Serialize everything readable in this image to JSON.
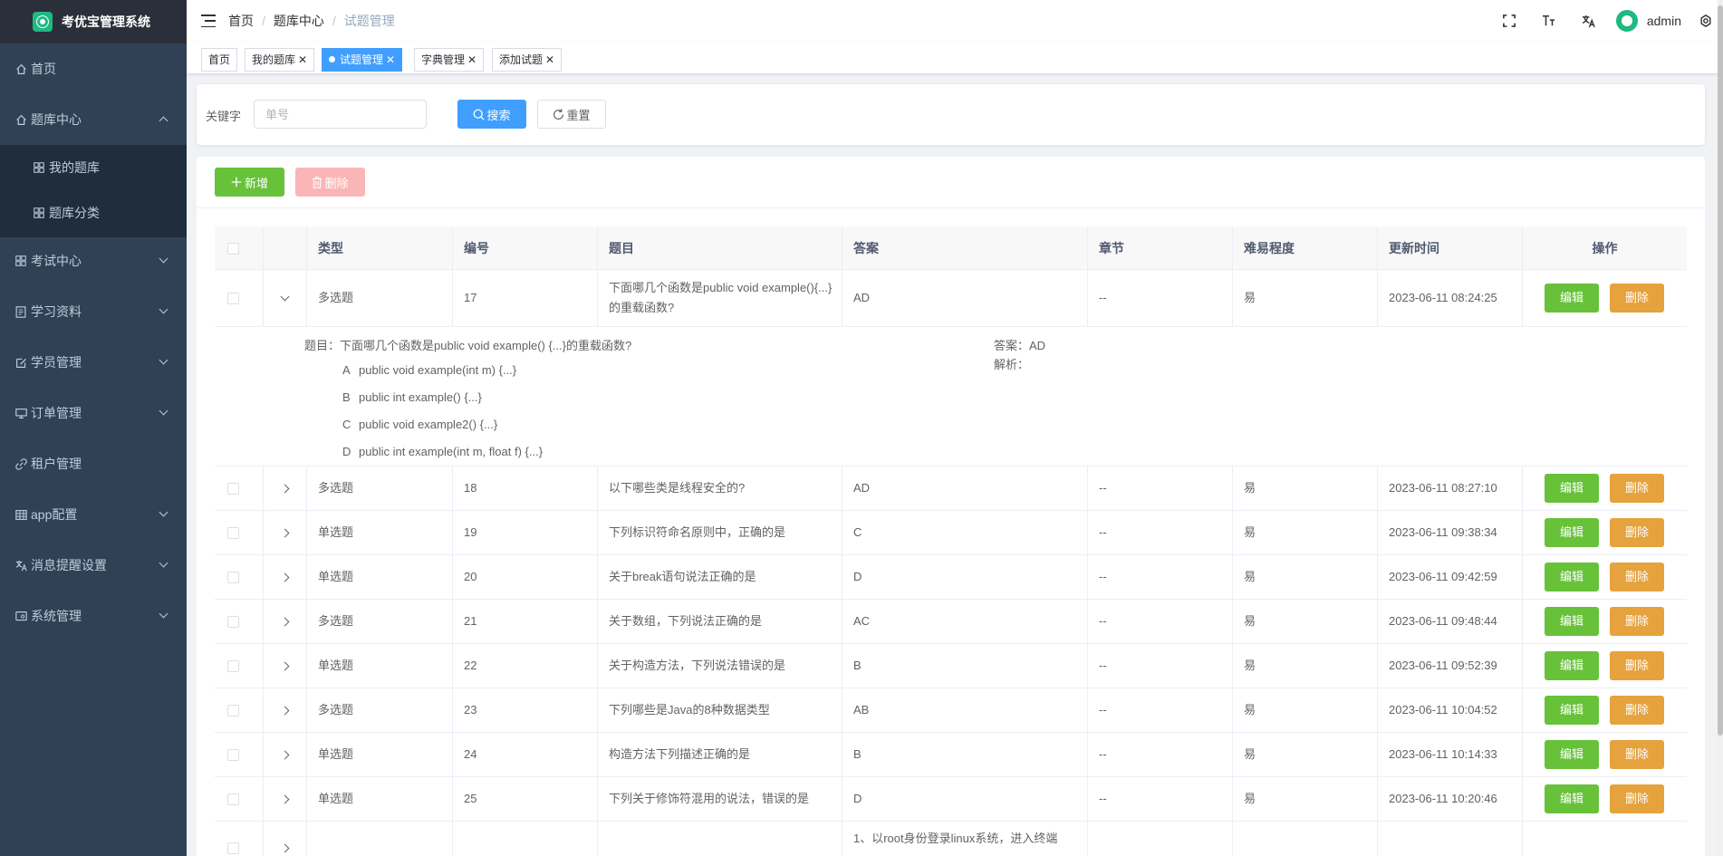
{
  "app": {
    "title": "考优宝管理系统"
  },
  "sidebar": {
    "items": [
      {
        "label": "首页",
        "icon": "home-icon"
      },
      {
        "label": "题库中心",
        "icon": "home-icon",
        "expanded": true
      },
      {
        "label": "我的题库",
        "icon": "grid-icon"
      },
      {
        "label": "题库分类",
        "icon": "grid-icon"
      },
      {
        "label": "考试中心",
        "icon": "grid-icon"
      },
      {
        "label": "学习资料",
        "icon": "document-icon"
      },
      {
        "label": "学员管理",
        "icon": "edit-icon"
      },
      {
        "label": "订单管理",
        "icon": "monitor-icon"
      },
      {
        "label": "租户管理",
        "icon": "link-icon"
      },
      {
        "label": "app配置",
        "icon": "table-icon"
      },
      {
        "label": "消息提醒设置",
        "icon": "translate-icon"
      },
      {
        "label": "系统管理",
        "icon": "system-icon"
      }
    ]
  },
  "breadcrumb": {
    "items": [
      "首页",
      "题库中心",
      "试题管理"
    ]
  },
  "header": {
    "user": "admin",
    "tools": [
      "fullscreen-icon",
      "font-size-icon",
      "translate-icon",
      "avatar",
      "settings-icon"
    ]
  },
  "tags": [
    {
      "label": "首页",
      "closable": false
    },
    {
      "label": "我的题库",
      "closable": true
    },
    {
      "label": "试题管理",
      "closable": true,
      "active": true
    },
    {
      "label": "字典管理",
      "closable": true
    },
    {
      "label": "添加试题",
      "closable": true
    }
  ],
  "search": {
    "label": "关键字",
    "placeholder": "单号",
    "search_button": "搜索",
    "reset_button": "重置"
  },
  "toolbar": {
    "add_button": "新增",
    "delete_button": "删除"
  },
  "table": {
    "columns": [
      "类型",
      "编号",
      "题目",
      "答案",
      "章节",
      "难易程度",
      "更新时间",
      "操作"
    ],
    "edit_label": "编辑",
    "delete_label": "删除",
    "rows": [
      {
        "type": "多选题",
        "num": "17",
        "title": "下面哪几个函数是public void example(){...}的重载函数?",
        "answer": "AD",
        "chapter": "--",
        "level": "易",
        "time": "2023-06-11 08:24:25",
        "expanded": true
      },
      {
        "type": "多选题",
        "num": "18",
        "title": "以下哪些类是线程安全的?",
        "answer": "AD",
        "chapter": "--",
        "level": "易",
        "time": "2023-06-11 08:27:10"
      },
      {
        "type": "单选题",
        "num": "19",
        "title": "下列标识符命名原则中，正确的是",
        "answer": "C",
        "chapter": "--",
        "level": "易",
        "time": "2023-06-11 09:38:34"
      },
      {
        "type": "单选题",
        "num": "20",
        "title": "关于break语句说法正确的是",
        "answer": "D",
        "chapter": "--",
        "level": "易",
        "time": "2023-06-11 09:42:59"
      },
      {
        "type": "多选题",
        "num": "21",
        "title": "关于数组，下列说法正确的是",
        "answer": "AC",
        "chapter": "--",
        "level": "易",
        "time": "2023-06-11 09:48:44"
      },
      {
        "type": "单选题",
        "num": "22",
        "title": "关于构造方法，下列说法错误的是",
        "answer": "B",
        "chapter": "--",
        "level": "易",
        "time": "2023-06-11 09:52:39"
      },
      {
        "type": "多选题",
        "num": "23",
        "title": "下列哪些是Java的8种数据类型",
        "answer": "AB",
        "chapter": "--",
        "level": "易",
        "time": "2023-06-11 10:04:52"
      },
      {
        "type": "单选题",
        "num": "24",
        "title": "构造方法下列描述正确的是",
        "answer": "B",
        "chapter": "--",
        "level": "易",
        "time": "2023-06-11 10:14:33"
      },
      {
        "type": "单选题",
        "num": "25",
        "title": "下列关于修饰符混用的说法，错误的是",
        "answer": "D",
        "chapter": "--",
        "level": "易",
        "time": "2023-06-11 10:20:46"
      },
      {
        "type": "",
        "num": "",
        "title": "",
        "answer": "1、以root身份登录linux系统，进入终端",
        "chapter": "",
        "level": "",
        "time": ""
      }
    ],
    "detail": {
      "question_label": "题目：",
      "question": "下面哪几个函数是public void example() {...}的重载函数?",
      "options": [
        {
          "letter": "A",
          "text": "public void example(int m) {...}"
        },
        {
          "letter": "B",
          "text": "public int example() {...}"
        },
        {
          "letter": "C",
          "text": "public void example2() {...}"
        },
        {
          "letter": "D",
          "text": "public int example(int m, float f) {...}"
        }
      ],
      "answer_label": "答案：",
      "answer": "AD",
      "analysis_label": "解析："
    }
  },
  "colors": {
    "sidebar": "#304156",
    "primary": "#409eff",
    "success": "#67c23a",
    "warning": "#e6a23c",
    "danger_light": "#fab6b6"
  }
}
